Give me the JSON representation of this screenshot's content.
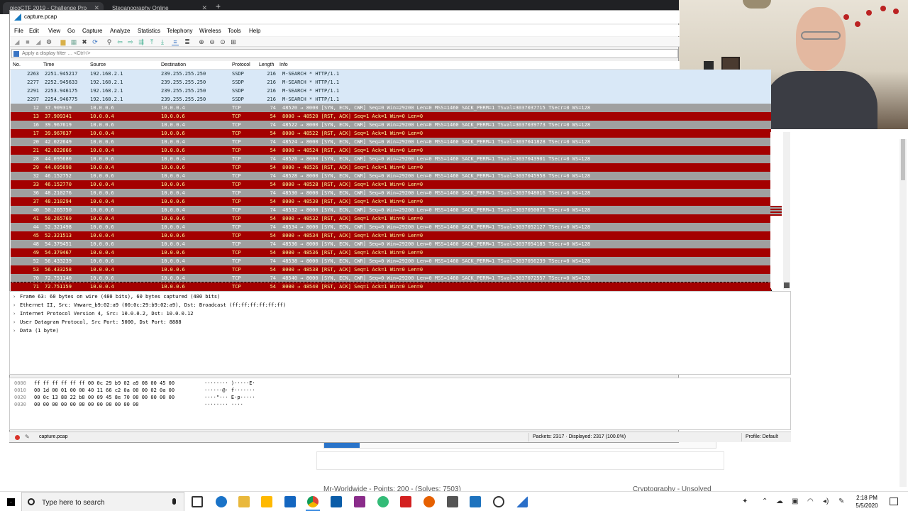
{
  "browser": {
    "tabs": [
      {
        "label": "picoCTF 2019 - Challenge Pro"
      },
      {
        "label": "Steganography Online"
      }
    ],
    "new_tab": "+",
    "challenge_left": "Mr-Worldwide - Points: 200 - (Solves: 7503)",
    "challenge_right": "Cryptography - Unsolved"
  },
  "wireshark": {
    "title": "capture.pcap",
    "menu": [
      "File",
      "Edit",
      "View",
      "Go",
      "Capture",
      "Analyze",
      "Statistics",
      "Telephony",
      "Wireless",
      "Tools",
      "Help"
    ],
    "filter_placeholder": "Apply a display filter … <Ctrl-/>",
    "columns": {
      "no": "No.",
      "time": "Time",
      "source": "Source",
      "destination": "Destination",
      "protocol": "Protocol",
      "length": "Length",
      "info": "Info"
    },
    "packets": [
      {
        "no": "2263",
        "time": "2251.945217",
        "src": "192.168.2.1",
        "dst": "239.255.255.250",
        "proto": "SSDP",
        "len": "216",
        "info": "M-SEARCH * HTTP/1.1",
        "kind": "ssdp"
      },
      {
        "no": "2277",
        "time": "2252.945633",
        "src": "192.168.2.1",
        "dst": "239.255.255.250",
        "proto": "SSDP",
        "len": "216",
        "info": "M-SEARCH * HTTP/1.1",
        "kind": "ssdp"
      },
      {
        "no": "2291",
        "time": "2253.946175",
        "src": "192.168.2.1",
        "dst": "239.255.255.250",
        "proto": "SSDP",
        "len": "216",
        "info": "M-SEARCH * HTTP/1.1",
        "kind": "ssdp"
      },
      {
        "no": "2297",
        "time": "2254.946775",
        "src": "192.168.2.1",
        "dst": "239.255.255.250",
        "proto": "SSDP",
        "len": "216",
        "info": "M-SEARCH * HTTP/1.1",
        "kind": "ssdp"
      },
      {
        "no": "12",
        "time": "37.909319",
        "src": "10.0.0.6",
        "dst": "10.0.0.4",
        "proto": "TCP",
        "len": "74",
        "info": "48520 → 8000 [SYN, ECN, CWR] Seq=0 Win=29200 Len=0 MSS=1460 SACK_PERM=1 TSval=3037037715 TSecr=0 WS=128",
        "kind": "syn"
      },
      {
        "no": "13",
        "time": "37.909341",
        "src": "10.0.0.4",
        "dst": "10.0.0.6",
        "proto": "TCP",
        "len": "54",
        "info": "8000 → 48520 [RST, ACK] Seq=1 Ack=1 Win=0 Len=0",
        "kind": "rst"
      },
      {
        "no": "16",
        "time": "39.967619",
        "src": "10.0.0.6",
        "dst": "10.0.0.4",
        "proto": "TCP",
        "len": "74",
        "info": "48522 → 8000 [SYN, ECN, CWR] Seq=0 Win=29200 Len=0 MSS=1460 SACK_PERM=1 TSval=3037039773 TSecr=0 WS=128",
        "kind": "syn"
      },
      {
        "no": "17",
        "time": "39.967637",
        "src": "10.0.0.4",
        "dst": "10.0.0.6",
        "proto": "TCP",
        "len": "54",
        "info": "8000 → 48522 [RST, ACK] Seq=1 Ack=1 Win=0 Len=0",
        "kind": "rst"
      },
      {
        "no": "20",
        "time": "42.022649",
        "src": "10.0.0.6",
        "dst": "10.0.0.4",
        "proto": "TCP",
        "len": "74",
        "info": "48524 → 8000 [SYN, ECN, CWR] Seq=0 Win=29200 Len=0 MSS=1460 SACK_PERM=1 TSval=3037041828 TSecr=0 WS=128",
        "kind": "syn"
      },
      {
        "no": "21",
        "time": "42.022666",
        "src": "10.0.0.4",
        "dst": "10.0.0.6",
        "proto": "TCP",
        "len": "54",
        "info": "8000 → 48524 [RST, ACK] Seq=1 Ack=1 Win=0 Len=0",
        "kind": "rst"
      },
      {
        "no": "28",
        "time": "44.095680",
        "src": "10.0.0.6",
        "dst": "10.0.0.4",
        "proto": "TCP",
        "len": "74",
        "info": "48526 → 8000 [SYN, ECN, CWR] Seq=0 Win=29200 Len=0 MSS=1460 SACK_PERM=1 TSval=3037043901 TSecr=0 WS=128",
        "kind": "syn"
      },
      {
        "no": "29",
        "time": "44.095698",
        "src": "10.0.0.4",
        "dst": "10.0.0.6",
        "proto": "TCP",
        "len": "54",
        "info": "8000 → 48526 [RST, ACK] Seq=1 Ack=1 Win=0 Len=0",
        "kind": "rst"
      },
      {
        "no": "32",
        "time": "46.152752",
        "src": "10.0.0.6",
        "dst": "10.0.0.4",
        "proto": "TCP",
        "len": "74",
        "info": "48528 → 8000 [SYN, ECN, CWR] Seq=0 Win=29200 Len=0 MSS=1460 SACK_PERM=1 TSval=3037045958 TSecr=0 WS=128",
        "kind": "syn"
      },
      {
        "no": "33",
        "time": "46.152770",
        "src": "10.0.0.4",
        "dst": "10.0.0.6",
        "proto": "TCP",
        "len": "54",
        "info": "8000 → 48528 [RST, ACK] Seq=1 Ack=1 Win=0 Len=0",
        "kind": "rst"
      },
      {
        "no": "36",
        "time": "48.210276",
        "src": "10.0.0.6",
        "dst": "10.0.0.4",
        "proto": "TCP",
        "len": "74",
        "info": "48530 → 8000 [SYN, ECN, CWR] Seq=0 Win=29200 Len=0 MSS=1460 SACK_PERM=1 TSval=3037048016 TSecr=0 WS=128",
        "kind": "syn"
      },
      {
        "no": "37",
        "time": "48.210294",
        "src": "10.0.0.4",
        "dst": "10.0.0.6",
        "proto": "TCP",
        "len": "54",
        "info": "8000 → 48530 [RST, ACK] Seq=1 Ack=1 Win=0 Len=0",
        "kind": "rst"
      },
      {
        "no": "40",
        "time": "50.265750",
        "src": "10.0.0.6",
        "dst": "10.0.0.4",
        "proto": "TCP",
        "len": "74",
        "info": "48532 → 8000 [SYN, ECN, CWR] Seq=0 Win=29200 Len=0 MSS=1460 SACK_PERM=1 TSval=3037050071 TSecr=0 WS=128",
        "kind": "syn"
      },
      {
        "no": "41",
        "time": "50.265769",
        "src": "10.0.0.4",
        "dst": "10.0.0.6",
        "proto": "TCP",
        "len": "54",
        "info": "8000 → 48532 [RST, ACK] Seq=1 Ack=1 Win=0 Len=0",
        "kind": "rst"
      },
      {
        "no": "44",
        "time": "52.321498",
        "src": "10.0.0.6",
        "dst": "10.0.0.4",
        "proto": "TCP",
        "len": "74",
        "info": "48534 → 8000 [SYN, ECN, CWR] Seq=0 Win=29200 Len=0 MSS=1460 SACK_PERM=1 TSval=3037052127 TSecr=0 WS=128",
        "kind": "syn"
      },
      {
        "no": "45",
        "time": "52.321513",
        "src": "10.0.0.4",
        "dst": "10.0.0.6",
        "proto": "TCP",
        "len": "54",
        "info": "8000 → 48534 [RST, ACK] Seq=1 Ack=1 Win=0 Len=0",
        "kind": "rst"
      },
      {
        "no": "48",
        "time": "54.379451",
        "src": "10.0.0.6",
        "dst": "10.0.0.4",
        "proto": "TCP",
        "len": "74",
        "info": "48536 → 8000 [SYN, ECN, CWR] Seq=0 Win=29200 Len=0 MSS=1460 SACK_PERM=1 TSval=3037054185 TSecr=0 WS=128",
        "kind": "syn"
      },
      {
        "no": "49",
        "time": "54.379467",
        "src": "10.0.0.4",
        "dst": "10.0.0.6",
        "proto": "TCP",
        "len": "54",
        "info": "8000 → 48536 [RST, ACK] Seq=1 Ack=1 Win=0 Len=0",
        "kind": "rst"
      },
      {
        "no": "52",
        "time": "56.433239",
        "src": "10.0.0.6",
        "dst": "10.0.0.4",
        "proto": "TCP",
        "len": "74",
        "info": "48538 → 8000 [SYN, ECN, CWR] Seq=0 Win=29200 Len=0 MSS=1460 SACK_PERM=1 TSval=3037056239 TSecr=0 WS=128",
        "kind": "syn"
      },
      {
        "no": "53",
        "time": "56.433258",
        "src": "10.0.0.4",
        "dst": "10.0.0.6",
        "proto": "TCP",
        "len": "54",
        "info": "8000 → 48538 [RST, ACK] Seq=1 Ack=1 Win=0 Len=0",
        "kind": "rst"
      },
      {
        "no": "70",
        "time": "72.751140",
        "src": "10.0.0.6",
        "dst": "10.0.0.4",
        "proto": "TCP",
        "len": "74",
        "info": "48540 → 8000 [SYN, ECN, CWR] Seq=0 Win=29200 Len=0 MSS=1460 SACK_PERM=1 TSval=3037072557 TSecr=0 WS=128",
        "kind": "syn"
      },
      {
        "no": "71",
        "time": "72.751159",
        "src": "10.0.0.4",
        "dst": "10.0.0.6",
        "proto": "TCP",
        "len": "54",
        "info": "8000 → 48540 [RST, ACK] Seq=1 Ack=1 Win=0 Len=0",
        "kind": "rst"
      }
    ],
    "details": [
      "Frame 63: 60 bytes on wire (480 bits), 60 bytes captured (480 bits)",
      "Ethernet II, Src: Vmware_b9:02:a9 (00:0c:29:b9:02:a9), Dst: Broadcast (ff:ff:ff:ff:ff:ff)",
      "Internet Protocol Version 4, Src: 10.0.0.2, Dst: 10.0.0.12",
      "User Datagram Protocol, Src Port: 5000, Dst Port: 8888",
      "Data (1 byte)"
    ],
    "bytes": [
      {
        "offset": "0000",
        "hex": "ff ff ff ff ff ff 00 0c  29 b9 02 a9 08 00 45 00",
        "ascii": "········ )·····E·"
      },
      {
        "offset": "0010",
        "hex": "00 1d 00 01 00 00 40 11  66 c2 0a 00 00 02 0a 00",
        "ascii": "······@· f·······"
      },
      {
        "offset": "0020",
        "hex": "00 0c 13 88 22 b8 00 09  45 8e 70 00 00 00 00 00",
        "ascii": "····\"··· E·p·····"
      },
      {
        "offset": "0030",
        "hex": "00 00 00 00 00 00 00 00  00 00 00 00",
        "ascii": "········ ····"
      }
    ],
    "status": {
      "file": "capture.pcap",
      "packets": "Packets: 2317 · Displayed: 2317 (100.0%)",
      "profile": "Profile: Default"
    }
  },
  "taskbar": {
    "search_placeholder": "Type here to search",
    "time": "2:18 PM",
    "date": "5/5/2020"
  },
  "colors": {
    "ssdp_row": "#d9e8f7",
    "syn_row": "#a0a0a0",
    "rst_row": "#a40000",
    "rst_text": "#fffc9c"
  }
}
